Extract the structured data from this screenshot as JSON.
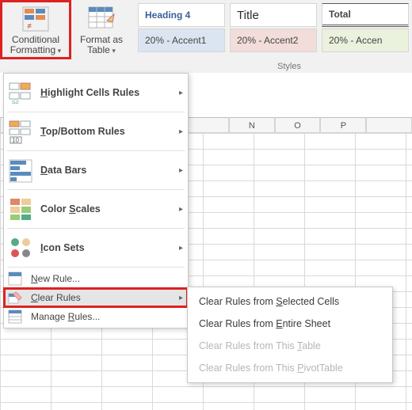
{
  "ribbon": {
    "cond_fmt_line1": "Conditional",
    "cond_fmt_line2": "Formatting",
    "fmt_table_line1": "Format as",
    "fmt_table_line2": "Table",
    "group_label": "Styles",
    "styles": {
      "heading4": "Heading 4",
      "title": "Title",
      "total": "Total",
      "acc1": "20% - Accent1",
      "acc2": "20% - Accent2",
      "acc3": "20% - Accen"
    }
  },
  "columns": [
    "",
    "",
    "",
    "",
    "",
    "N",
    "O",
    "P",
    ""
  ],
  "menu": {
    "highlight": "Highlight Cells Rules",
    "topbottom": "Top/Bottom Rules",
    "databars": "Data Bars",
    "colorscales": "Color Scales",
    "iconsets": "Icon Sets",
    "newrule": "New Rule...",
    "clearrules": "Clear Rules",
    "managerules": "Manage Rules...",
    "hk": {
      "highlight": "H",
      "topbottom": "T",
      "databars": "D",
      "colorscales": "S",
      "iconsets": "I",
      "newrule": "N",
      "clearrules": "C",
      "managerules": "R"
    }
  },
  "submenu": {
    "selected": "Clear Rules from Selected Cells",
    "sheet": "Clear Rules from Entire Sheet",
    "table": "Clear Rules from This Table",
    "pivot": "Clear Rules from This PivotTable",
    "hk": {
      "selected": "S",
      "sheet": "E",
      "table": "T",
      "pivot": "P"
    }
  }
}
